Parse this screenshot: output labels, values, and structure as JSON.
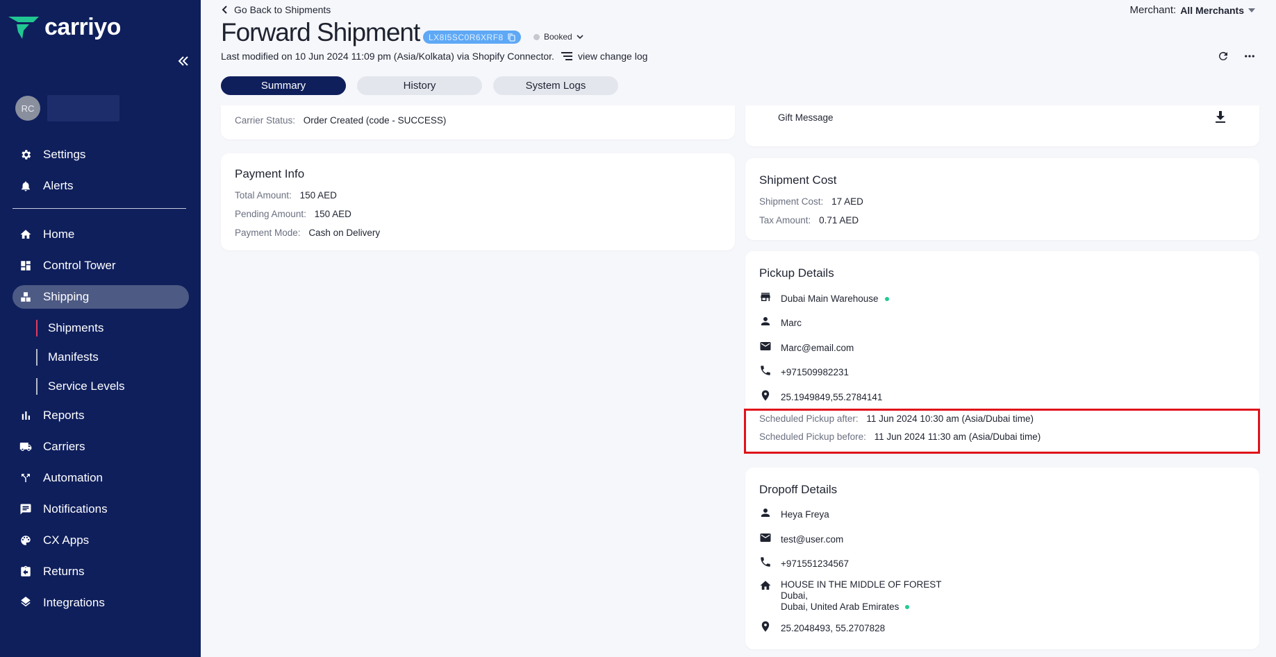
{
  "brand": {
    "name": "carriyo",
    "mark_color": "#21c792"
  },
  "sidebar": {
    "user_initials": "RC",
    "top_items": [
      {
        "label": "Settings",
        "icon": "gear-icon"
      },
      {
        "label": "Alerts",
        "icon": "bell-icon"
      }
    ],
    "items": [
      {
        "label": "Home",
        "icon": "home-icon"
      },
      {
        "label": "Control Tower",
        "icon": "dashboard-icon"
      },
      {
        "label": "Shipping",
        "icon": "boxes-icon"
      },
      {
        "label": "Reports",
        "icon": "bar-chart-icon"
      },
      {
        "label": "Carriers",
        "icon": "truck-icon"
      },
      {
        "label": "Automation",
        "icon": "fork-icon"
      },
      {
        "label": "Notifications",
        "icon": "message-icon"
      },
      {
        "label": "CX Apps",
        "icon": "palette-icon"
      },
      {
        "label": "Returns",
        "icon": "return-clipboard-icon"
      },
      {
        "label": "Integrations",
        "icon": "layers-icon"
      }
    ],
    "shipping_sub": [
      "Shipments",
      "Manifests",
      "Service Levels"
    ]
  },
  "header": {
    "back_label": "Go Back to Shipments",
    "merchant_label": "Merchant:",
    "merchant_value": "All Merchants",
    "title": "Forward Shipment",
    "awb": "LX8I5SC0R6XRF8",
    "status": "Booked",
    "modified": "Last modified on 10 Jun 2024 11:09 pm (Asia/Kolkata) via Shopify Connector.",
    "changelog": "view change log"
  },
  "tabs": [
    "Summary",
    "History",
    "System Logs"
  ],
  "carrier_status": {
    "label": "Carrier Status:",
    "value": "Order Created (code - SUCCESS)"
  },
  "gift": {
    "label": "Gift Message"
  },
  "payment": {
    "title": "Payment Info",
    "rows": [
      {
        "k": "Total Amount:",
        "v": "150 AED"
      },
      {
        "k": "Pending Amount:",
        "v": "150 AED"
      },
      {
        "k": "Payment Mode:",
        "v": "Cash on Delivery"
      }
    ]
  },
  "shipment_cost": {
    "title": "Shipment Cost",
    "rows": [
      {
        "k": "Shipment Cost:",
        "v": "17 AED"
      },
      {
        "k": "Tax Amount:",
        "v": "0.71 AED"
      }
    ]
  },
  "pickup": {
    "title": "Pickup Details",
    "location": "Dubai Main Warehouse",
    "contact": "Marc",
    "email": "Marc@email.com",
    "phone": "+971509982231",
    "coords": "25.1949849,55.2784141",
    "after_label": "Scheduled Pickup after:",
    "after_value": "11 Jun 2024 10:30 am (Asia/Dubai time)",
    "before_label": "Scheduled Pickup before:",
    "before_value": "11 Jun 2024 11:30 am (Asia/Dubai time)"
  },
  "dropoff": {
    "title": "Dropoff Details",
    "contact": "Heya Freya",
    "email": "test@user.com",
    "phone": "+971551234567",
    "address_line1": "HOUSE IN THE MIDDLE OF FOREST",
    "address_line2": "Dubai,",
    "address_line3": "Dubai, United Arab Emirates",
    "coords": "25.2048493, 55.2707828"
  }
}
